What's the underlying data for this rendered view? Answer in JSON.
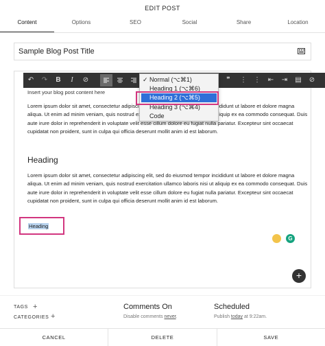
{
  "header": {
    "title": "EDIT POST"
  },
  "tabs": [
    {
      "label": "Content"
    },
    {
      "label": "Options"
    },
    {
      "label": "SEO"
    },
    {
      "label": "Social"
    },
    {
      "label": "Share"
    },
    {
      "label": "Location"
    }
  ],
  "post": {
    "title": "Sample Blog Post Title",
    "placeholder": "Insert your blog post content here",
    "paragraph": "Lorem ipsum dolor sit amet, consectetur adipiscing elit, sed do eiusmod tempor incididunt ut labore et dolore magna aliqua. Ut enim ad minim veniam, quis nostrud exercitation ullamco laboris nisi ut aliquip ex ea commodo consequat. Duis aute irure dolor in reprehenderit in voluptate velit esse cillum dolore eu fugiat nulla pariatur. Excepteur sint occaecat cupidatat non proident, sunt in culpa qui officia deserunt mollit anim id est laborum.",
    "heading": "Heading",
    "selected_heading": "Heading"
  },
  "format_menu": {
    "items": [
      {
        "label": "Normal (⌥⌘1)",
        "checked": true
      },
      {
        "label": "Heading 1 (⌥⌘6)"
      },
      {
        "label": "Heading 2 (⌥⌘5)",
        "highlighted": true
      },
      {
        "label": "Heading 3 (⌥⌘4)"
      },
      {
        "label": "Code"
      }
    ]
  },
  "meta": {
    "tags_label": "TAGS",
    "categories_label": "CATEGORIES",
    "comments_title": "Comments On",
    "comments_sub_prefix": "Disable comments ",
    "comments_sub_link": "never",
    "comments_sub_suffix": ".",
    "schedule_title": "Scheduled",
    "schedule_sub_prefix": "Publish ",
    "schedule_sub_link": "today",
    "schedule_sub_suffix": " at 9:22am."
  },
  "footer": {
    "cancel_label": "CANCEL",
    "delete_label": "DELETE",
    "save_label": "SAVE"
  },
  "colors": {
    "highlight_border": "#d2357f",
    "menu_selected": "#2f6fd8",
    "toolbar_bg": "#333333"
  }
}
